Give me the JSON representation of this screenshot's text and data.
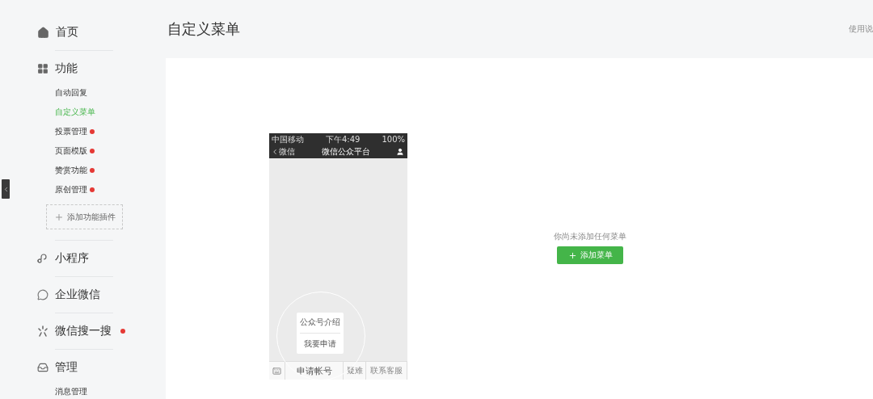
{
  "sidebar": {
    "groups": [
      {
        "label": "首页",
        "dot": false
      },
      {
        "label": "功能",
        "dot": false,
        "items": [
          {
            "label": "自动回复",
            "selected": false,
            "dot": false
          },
          {
            "label": "自定义菜单",
            "selected": true,
            "dot": false
          },
          {
            "label": "投票管理",
            "selected": false,
            "dot": true
          },
          {
            "label": "页面模版",
            "selected": false,
            "dot": true
          },
          {
            "label": "赞赏功能",
            "selected": false,
            "dot": true
          },
          {
            "label": "原创管理",
            "selected": false,
            "dot": true
          }
        ],
        "add_button": "添加功能插件"
      },
      {
        "label": "小程序",
        "dot": false
      },
      {
        "label": "企业微信",
        "dot": false
      },
      {
        "label": "微信搜一搜",
        "dot": true
      },
      {
        "label": "管理",
        "dot": false,
        "items": [
          {
            "label": "消息管理",
            "selected": false,
            "dot": false
          }
        ]
      }
    ]
  },
  "header": {
    "title": "自定义菜单",
    "help_link": "使用说"
  },
  "phone": {
    "status": {
      "carrier": "中国移动",
      "time": "下午4:49",
      "battery": "100%"
    },
    "nav": {
      "back": "微信",
      "title": "微信公众平台"
    },
    "popup": [
      "公众号介绍",
      "我要申请"
    ],
    "tabs": [
      "申请帐号",
      "疑难",
      "联系客服"
    ]
  },
  "empty_state": {
    "text": "你尚未添加任何菜单",
    "add_button": "添加菜单"
  }
}
